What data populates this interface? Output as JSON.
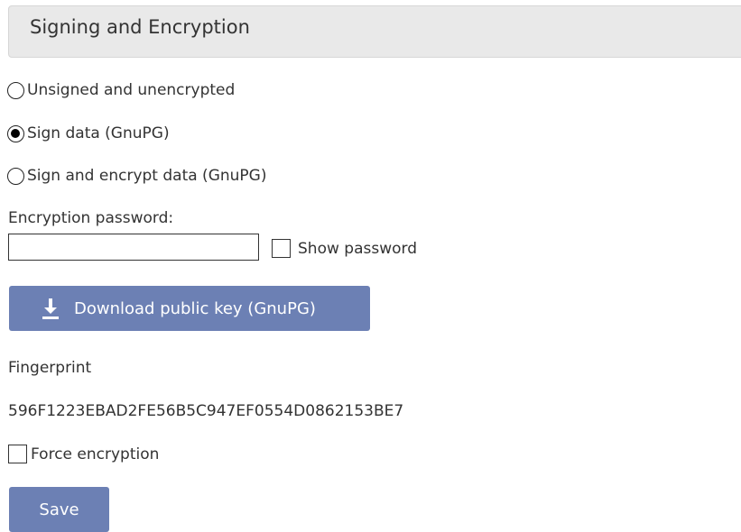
{
  "section": {
    "title": "Signing and Encryption"
  },
  "options": [
    {
      "label": "Unsigned and unencrypted",
      "checked": false
    },
    {
      "label": "Sign data (GnuPG)",
      "checked": true
    },
    {
      "label": "Sign and encrypt data (GnuPG)",
      "checked": false
    }
  ],
  "password": {
    "label": "Encryption password:",
    "value": "",
    "show_label": "Show password",
    "show_checked": false
  },
  "download": {
    "label": "Download public key (GnuPG)",
    "icon": "download-icon"
  },
  "fingerprint": {
    "label": "Fingerprint",
    "value": "596F1223EBAD2FE56B5C947EF0554D0862153BE7"
  },
  "force_encryption": {
    "label": "Force encryption",
    "checked": false
  },
  "save": {
    "label": "Save"
  },
  "colors": {
    "button": "#6c80b4",
    "header_bg": "#e9e9e9"
  }
}
